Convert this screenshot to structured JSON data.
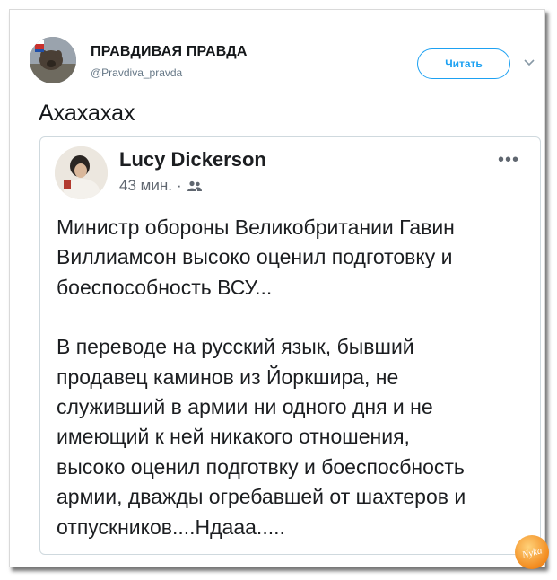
{
  "tweet": {
    "account_name": "ПРАВДИВАЯ ПРАВДА",
    "account_handle": "@Pravdiva_pravda",
    "follow_label": "Читать",
    "text": "Ахахахах"
  },
  "quoted_post": {
    "author_name": "Lucy Dickerson",
    "time_label": "43 мин.",
    "separator": "·",
    "more_label": "•••",
    "paragraph1": [
      "Министр обороны Великобритании Гавин",
      "Виллиамсон высоко оценил подготовку и",
      "боеспособность ВСУ..."
    ],
    "paragraph2": [
      "В переводе на русский язык, бывший",
      "продавец каминов из Йоркшира, не",
      "служивший в армии ни одного дня и не",
      "имеющий к ней никакого отношения,",
      "высоко оценил подготвку и боеспосбность",
      "армии, дважды огребавшей от шахтеров и",
      "отпускников....Ндааа....."
    ]
  },
  "watermark": {
    "text": "Nyka"
  },
  "colors": {
    "twitter_blue": "#1da1f2",
    "secondary_text": "#657786",
    "facebook_meta": "#606770",
    "card_border": "#cfd9de"
  },
  "icons": [
    "avatar-image",
    "chevron-down-icon",
    "friends-audience-icon",
    "more-options-icon"
  ]
}
